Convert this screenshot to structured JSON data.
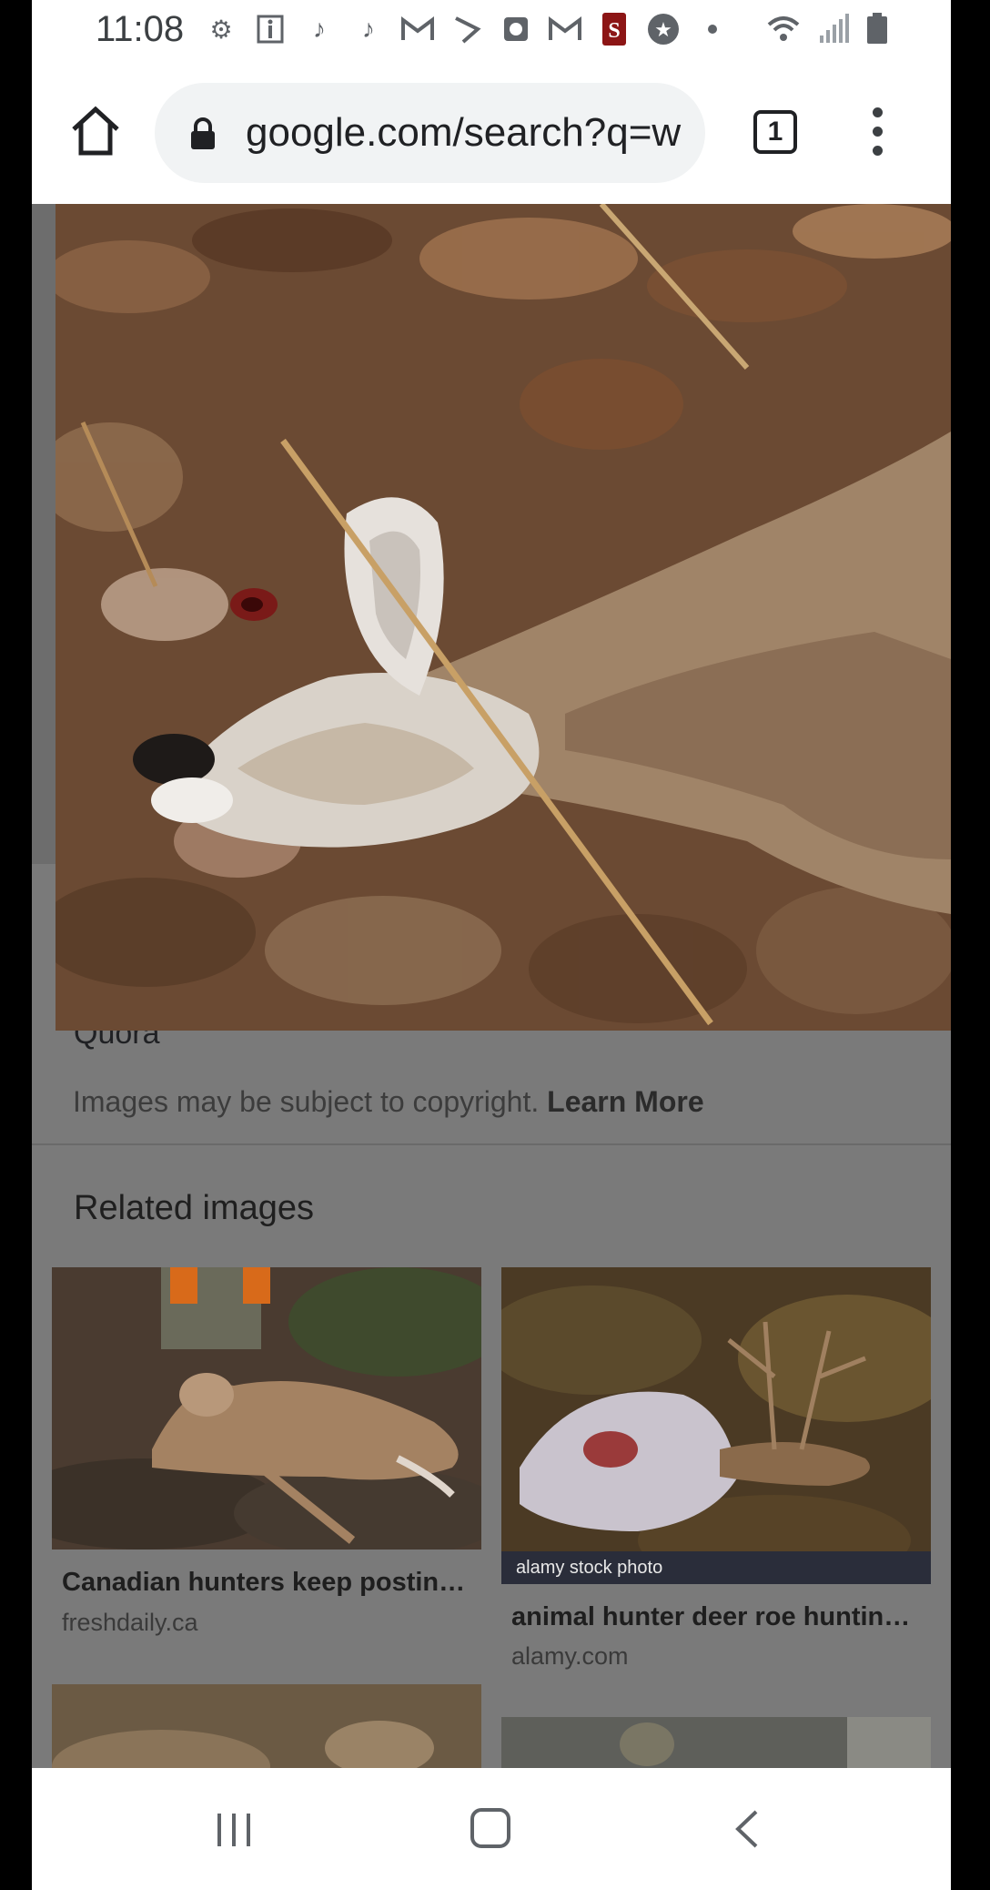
{
  "status_bar": {
    "time": "11:08",
    "icons": [
      "gear-icon",
      "info-icon",
      "tiktok-icon",
      "tiktok-icon",
      "gmail-icon",
      "sprint-icon",
      "clock-icon",
      "gmail-icon",
      "stanford-icon",
      "star-icon",
      "dot-icon"
    ],
    "right_icons": [
      "wifi-icon",
      "signal-icon",
      "battery-icon"
    ]
  },
  "browser": {
    "url": "google.com/search?q=w",
    "tab_count": "1"
  },
  "viewer": {
    "source": "Quora",
    "copyright_text": "Images may be subject to copyright.",
    "learn_more": "Learn More"
  },
  "related": {
    "title": "Related images",
    "cards": [
      {
        "title": "Canadian hunters keep postin…",
        "domain": "freshdaily.ca"
      },
      {
        "title": "animal hunter deer roe huntin…",
        "domain": "alamy.com",
        "watermark": "alamy stock photo"
      }
    ]
  },
  "colors": {
    "scrim": "#7a7a7a",
    "omnibox": "#f1f3f4"
  }
}
